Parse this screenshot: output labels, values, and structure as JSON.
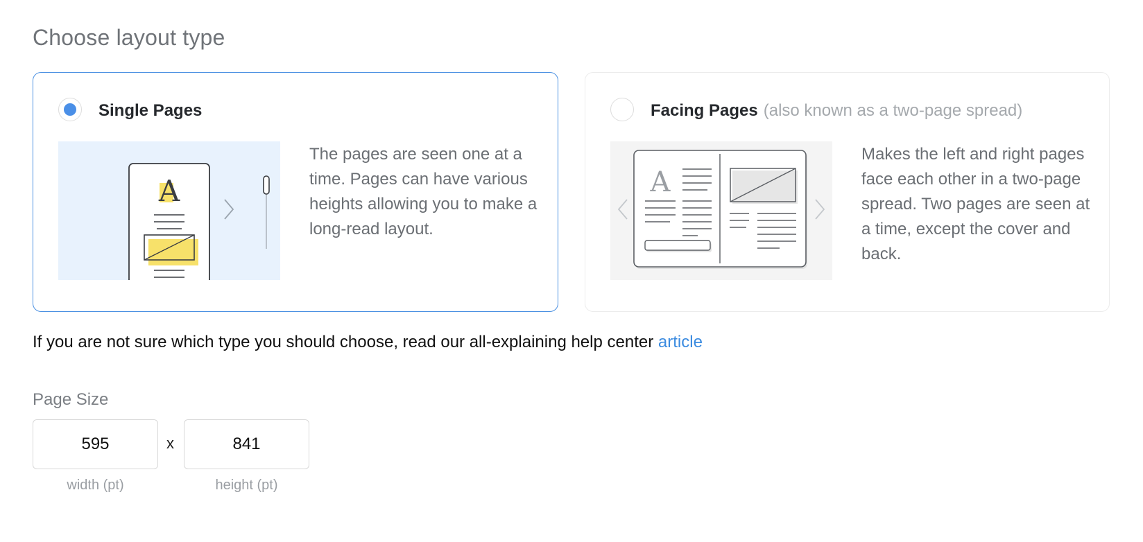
{
  "heading": "Choose layout type",
  "layouts": [
    {
      "label": "Single Pages",
      "sublabel": "",
      "selected": true,
      "description": "The pages are seen one at a time. Pages can have various heights allowing you to make a long-read layout.",
      "illustration_icon": "single-page-scroll-illustration"
    },
    {
      "label": "Facing Pages",
      "sublabel": "(also known as a two-page spread)",
      "selected": false,
      "description": "Makes the left and right pages face each other in a two-page spread. Two pages are seen at a time, except the cover and back.",
      "illustration_icon": "two-page-spread-illustration"
    }
  ],
  "help": {
    "text": "If you are not sure which type you should choose, read our all-explaining help center",
    "link_label": "article"
  },
  "page_size": {
    "label": "Page Size",
    "width_value": "595",
    "height_value": "841",
    "separator": "x",
    "width_caption": "width (pt)",
    "height_caption": "height (pt)"
  },
  "colors": {
    "accent": "#4a8fe7",
    "link": "#3b8be0",
    "highlight_yellow": "#f7e16a",
    "single_bg": "#e8f2fd",
    "facing_bg": "#f4f4f4"
  }
}
